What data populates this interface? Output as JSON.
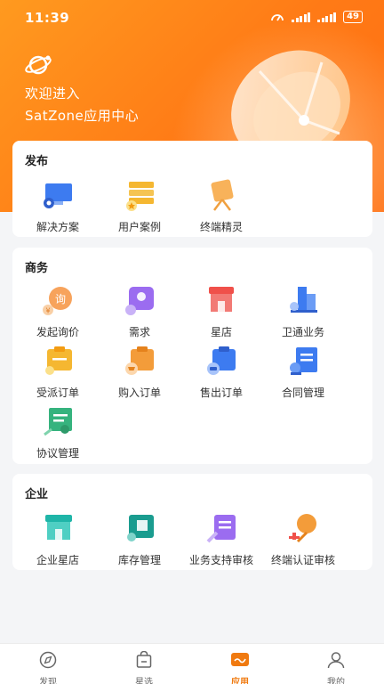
{
  "status_bar": {
    "time": "11:39",
    "battery": "49"
  },
  "header": {
    "welcome_line1": "欢迎进入",
    "welcome_line2": "SatZone应用中心"
  },
  "sections": {
    "publish": {
      "title": "发布",
      "items": [
        {
          "label": "解决方案",
          "icon": "solution-icon"
        },
        {
          "label": "用户案例",
          "icon": "user-case-icon"
        },
        {
          "label": "终端精灵",
          "icon": "terminal-sprite-icon"
        }
      ]
    },
    "business": {
      "title": "商务",
      "items": [
        {
          "label": "发起询价",
          "icon": "inquiry-icon"
        },
        {
          "label": "需求",
          "icon": "demand-icon"
        },
        {
          "label": "星店",
          "icon": "star-shop-icon"
        },
        {
          "label": "卫通业务",
          "icon": "satcom-business-icon"
        },
        {
          "label": "受派订单",
          "icon": "assigned-order-icon"
        },
        {
          "label": "购入订单",
          "icon": "purchase-order-icon"
        },
        {
          "label": "售出订单",
          "icon": "sales-order-icon"
        },
        {
          "label": "合同管理",
          "icon": "contract-icon"
        },
        {
          "label": "协议管理",
          "icon": "agreement-icon"
        }
      ]
    },
    "enterprise": {
      "title": "企业",
      "items": [
        {
          "label": "企业星店",
          "icon": "enterprise-shop-icon"
        },
        {
          "label": "库存管理",
          "icon": "inventory-icon"
        },
        {
          "label": "业务支持审核",
          "icon": "support-review-icon"
        },
        {
          "label": "终端认证审核",
          "icon": "terminal-cert-icon"
        }
      ]
    }
  },
  "tabbar": [
    {
      "label": "发现",
      "icon": "compass-icon"
    },
    {
      "label": "星选",
      "icon": "bag-icon"
    },
    {
      "label": "应用",
      "icon": "apps-icon",
      "active": true
    },
    {
      "label": "我的",
      "icon": "profile-icon"
    }
  ],
  "colors": {
    "accent": "#f07a10",
    "hero_start": "#ff9a1f",
    "hero_end": "#ff6e12"
  }
}
